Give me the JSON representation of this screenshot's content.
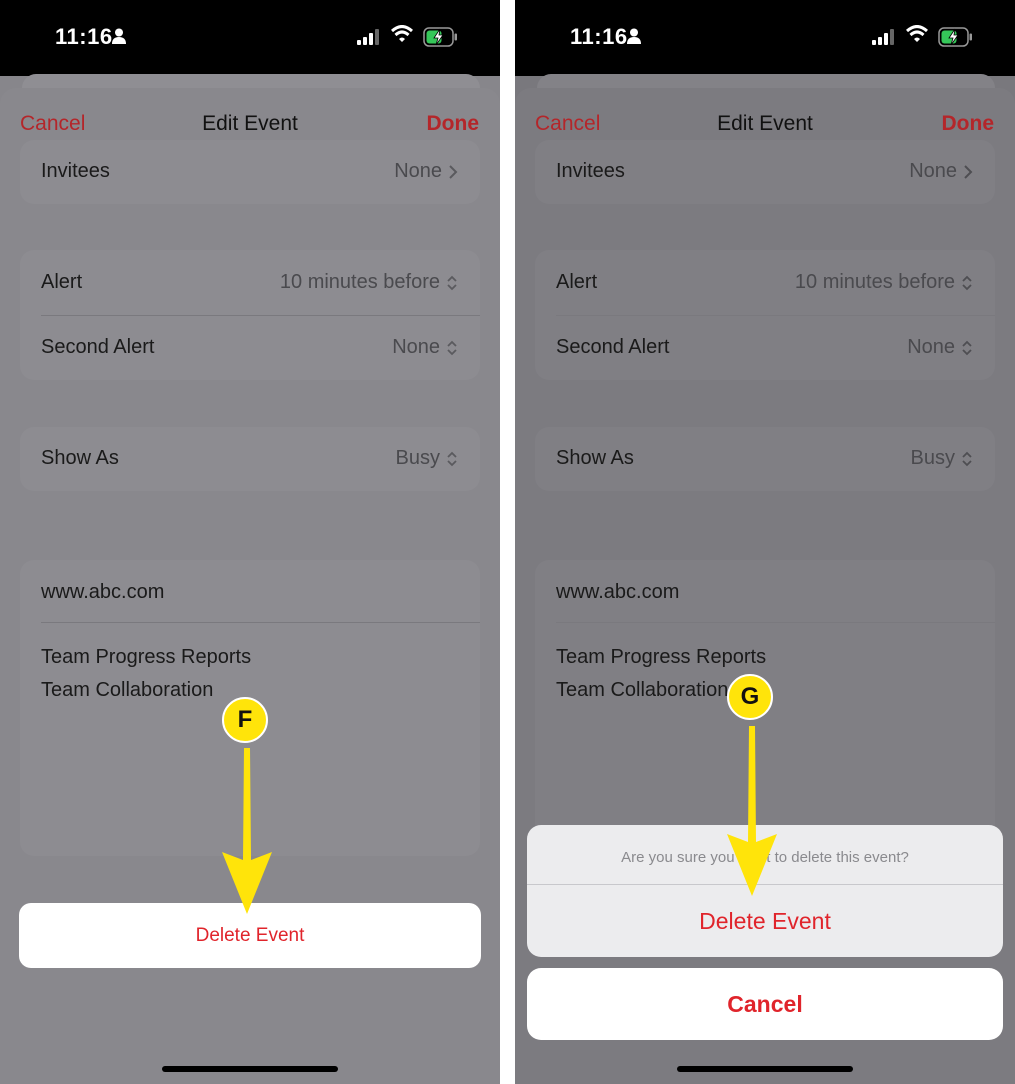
{
  "status": {
    "time": "11:16"
  },
  "nav": {
    "cancel": "Cancel",
    "title": "Edit Event",
    "done": "Done"
  },
  "rows": {
    "invitees": {
      "label": "Invitees",
      "value": "None"
    },
    "alert": {
      "label": "Alert",
      "value": "10 minutes before"
    },
    "second_alert": {
      "label": "Second Alert",
      "value": "None"
    },
    "show_as": {
      "label": "Show As",
      "value": "Busy"
    }
  },
  "notes": {
    "url": "www.abc.com",
    "lines": [
      "Team Progress Reports",
      "Team Collaboration"
    ]
  },
  "delete_button": "Delete Event",
  "action_sheet": {
    "message": "Are you sure you want to delete this event?",
    "delete": "Delete Event",
    "cancel": "Cancel"
  },
  "markers": {
    "left": "F",
    "right": "G"
  },
  "colors": {
    "accent_red": "#e0242b",
    "callout_yellow": "#ffe40a"
  },
  "icons": [
    "person-icon",
    "signal-icon",
    "wifi-icon",
    "battery-charging-icon",
    "chevron-right-icon",
    "chevron-updown-icon",
    "arrow-down-icon"
  ]
}
